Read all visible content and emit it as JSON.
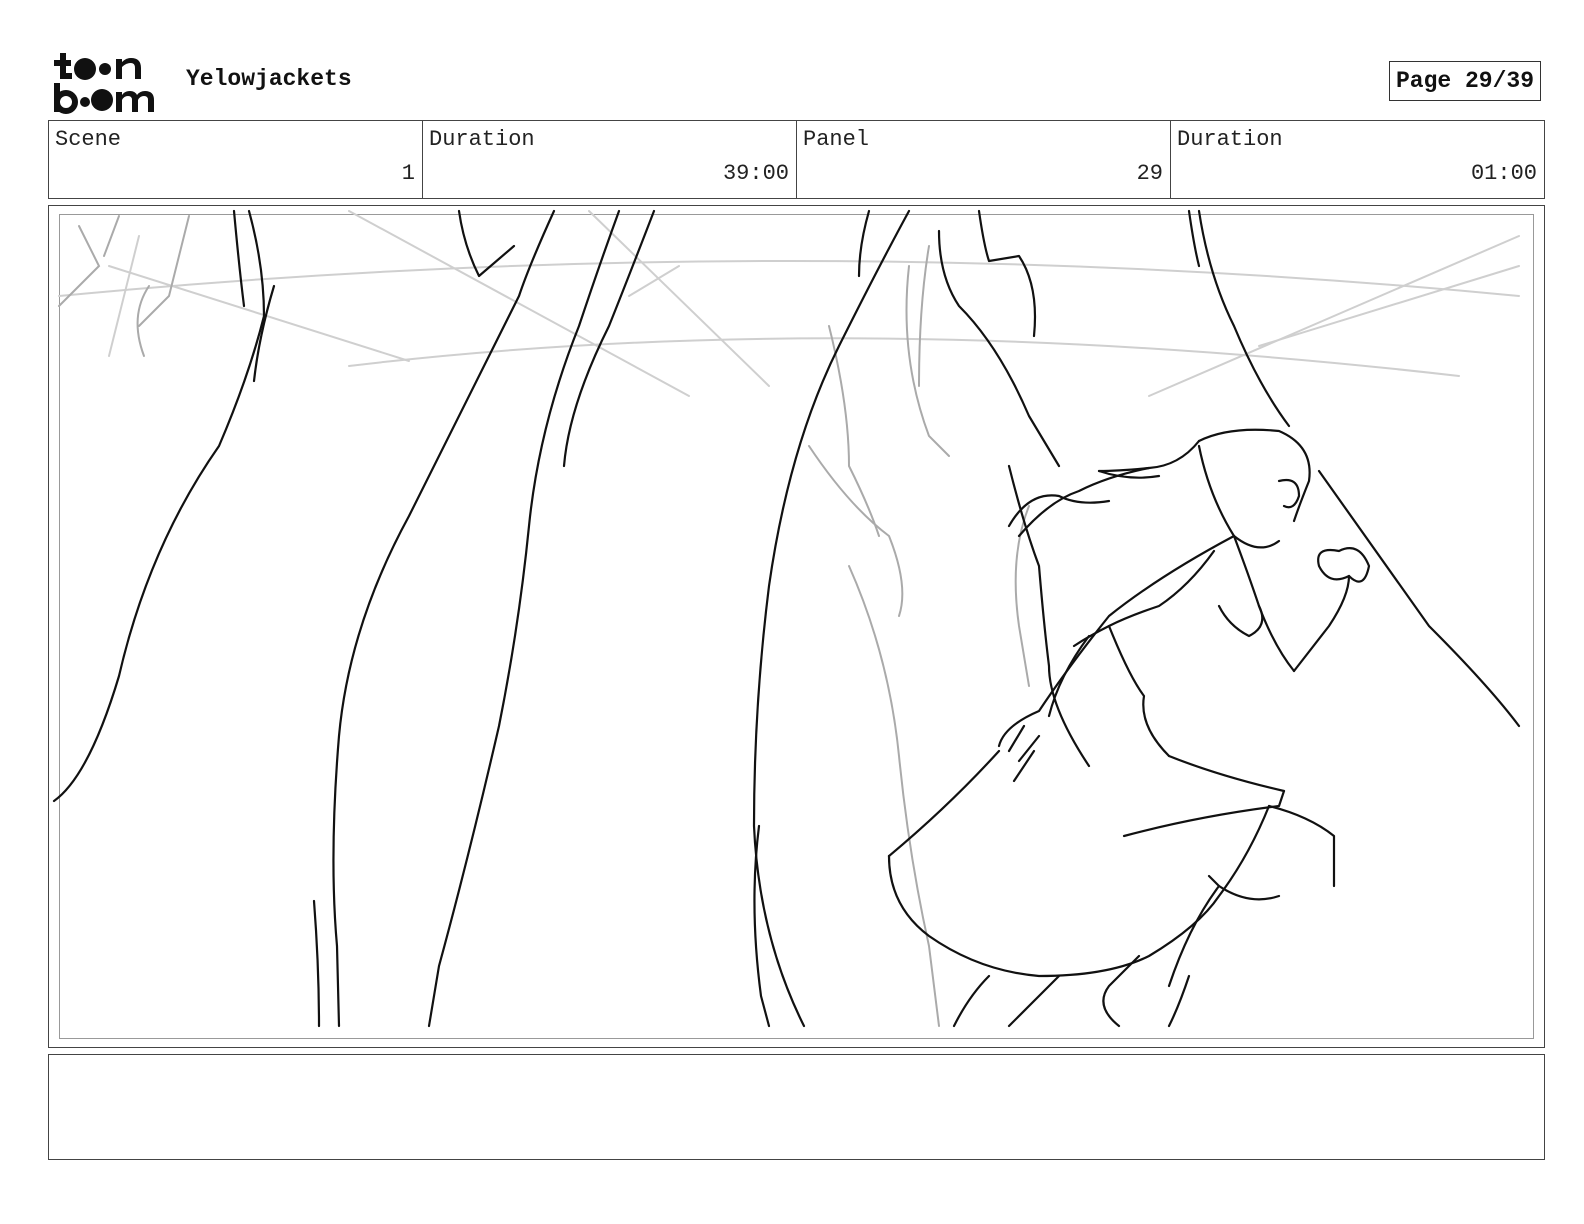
{
  "header": {
    "logo_icon": "toon-boom-logo",
    "project_title": "Yelowjackets",
    "page_label": "Page 29/39"
  },
  "info": {
    "scene_label": "Scene",
    "scene_value": "1",
    "scene_duration_label": "Duration",
    "scene_duration_value": "39:00",
    "panel_label": "Panel",
    "panel_value": "29",
    "panel_duration_label": "Duration",
    "panel_duration_value": "01:00"
  },
  "panel": {
    "image_icon": "storyboard-sketch-forest-girl-running"
  },
  "notes": {
    "text": ""
  }
}
